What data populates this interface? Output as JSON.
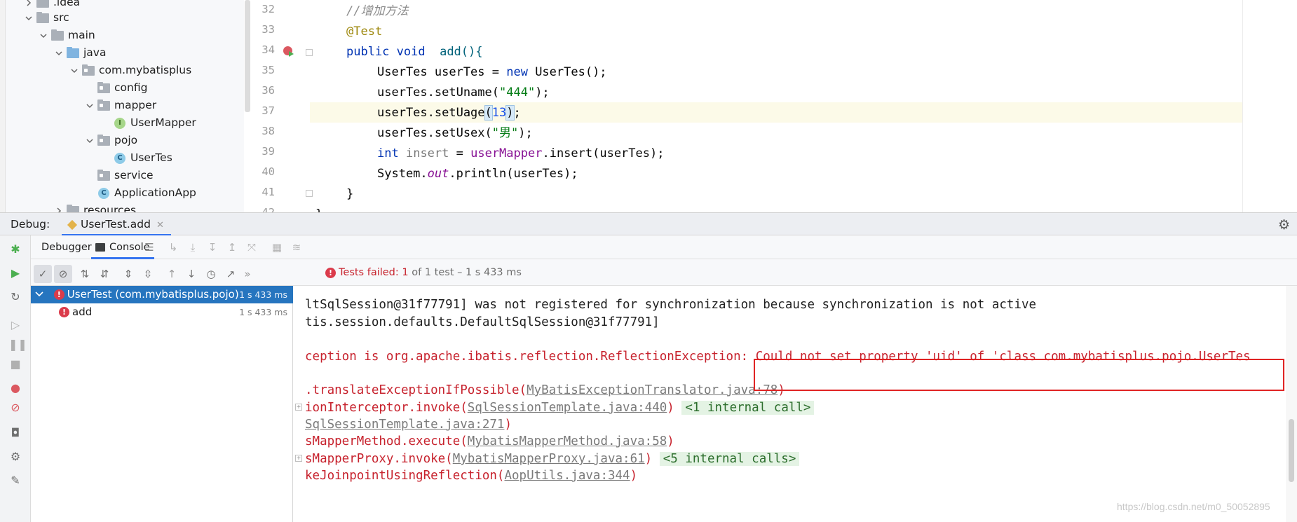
{
  "project_tree": [
    {
      "label": ".idea",
      "kind": "folder",
      "expanded": false
    },
    {
      "label": "src",
      "kind": "folder",
      "expanded": true
    },
    {
      "label": "main",
      "kind": "folder",
      "expanded": true
    },
    {
      "label": "java",
      "kind": "source-folder",
      "expanded": true
    },
    {
      "label": "com.mybatisplus",
      "kind": "package",
      "expanded": true
    },
    {
      "label": "config",
      "kind": "package"
    },
    {
      "label": "mapper",
      "kind": "package",
      "expanded": true
    },
    {
      "label": "UserMapper",
      "kind": "interface",
      "icon_letter": "I"
    },
    {
      "label": "pojo",
      "kind": "package",
      "expanded": true
    },
    {
      "label": "UserTes",
      "kind": "class",
      "icon_letter": "C"
    },
    {
      "label": "service",
      "kind": "package"
    },
    {
      "label": "ApplicationApp",
      "kind": "class",
      "icon_letter": "C"
    },
    {
      "label": "resources",
      "kind": "folder",
      "expanded": false
    }
  ],
  "editor": {
    "line_numbers": [
      "32",
      "33",
      "34",
      "35",
      "36",
      "37",
      "38",
      "39",
      "40",
      "41",
      "42"
    ],
    "lines": {
      "l32": "//增加方法",
      "l33": "@Test",
      "l34_kw": "public void",
      "l34_rest": "add(){",
      "l35_a": "UserTes userTes = ",
      "l35_kw": "new",
      "l35_b": " UserTes();",
      "l36_a": "userTes.setUname(",
      "l36_str": "\"444\"",
      "l36_b": ");",
      "l37_a": "userTes.setUage",
      "l37_p1": "(",
      "l37_num": "13",
      "l37_p2": ")",
      "l37_b": ";",
      "l38_a": "userTes.setUsex(",
      "l38_str": "\"男\"",
      "l38_b": ");",
      "l39_kw": "int",
      "l39_var": "insert",
      "l39_eq": " = ",
      "l39_fld": "userMapper",
      "l39_b": ".insert(userTes);",
      "l40_a": "System.",
      "l40_out": "out",
      "l40_b": ".println(userTes);",
      "l41": "}",
      "l42": "}"
    }
  },
  "debug": {
    "label": "Debug:",
    "tab_label": "UserTest.add",
    "close_glyph": "✕",
    "subtabs": {
      "debugger": "Debugger",
      "console": "Console"
    },
    "status": {
      "failed_label": "Tests failed:",
      "failed_count": "1",
      "rest": "of 1 test – 1 s 433 ms"
    },
    "results": [
      {
        "label": "UserTest (com.mybatisplus.pojo)",
        "time": "1 s 433 ms",
        "selected": true
      },
      {
        "label": "add",
        "time": "1 s 433 ms",
        "selected": false
      }
    ]
  },
  "console": {
    "l1": "ltSqlSession@31f77791] was not registered for synchronization because synchronization is not active",
    "l2": "tis.session.defaults.DefaultSqlSession@31f77791]",
    "l3": "ception is org.apache.ibatis.reflection.ReflectionException: Could not set property 'uid' of 'class com.mybatisplus.pojo.UserTes",
    "l4_a": ".translateExceptionIfPossible(",
    "l4_link": "MyBatisExceptionTranslator.java:78",
    "l4_b": ")",
    "l5_a": "ionInterceptor.invoke(",
    "l5_link": "SqlSessionTemplate.java:440",
    "l5_b": ") ",
    "l5_internal": "<1 internal call>",
    "l6_link": "SqlSessionTemplate.java:271",
    "l6_b": ")",
    "l7_a": "sMapperMethod.execute(",
    "l7_link": "MybatisMapperMethod.java:58",
    "l7_b": ")",
    "l8_a": "sMapperProxy.invoke(",
    "l8_link": "MybatisMapperProxy.java:61",
    "l8_b": ") ",
    "l8_internal": "<5 internal calls>",
    "l9_a": "keJoinpointUsingReflection(",
    "l9_link": "AopUtils.java:344",
    "l9_b": ")"
  },
  "watermark": "https://blog.csdn.net/m0_50052895",
  "colors": {
    "keyword": "#0033b3",
    "string": "#067d17",
    "error_text": "#c7222d",
    "selection": "#2675bf",
    "highlight_box": "#e02424"
  }
}
